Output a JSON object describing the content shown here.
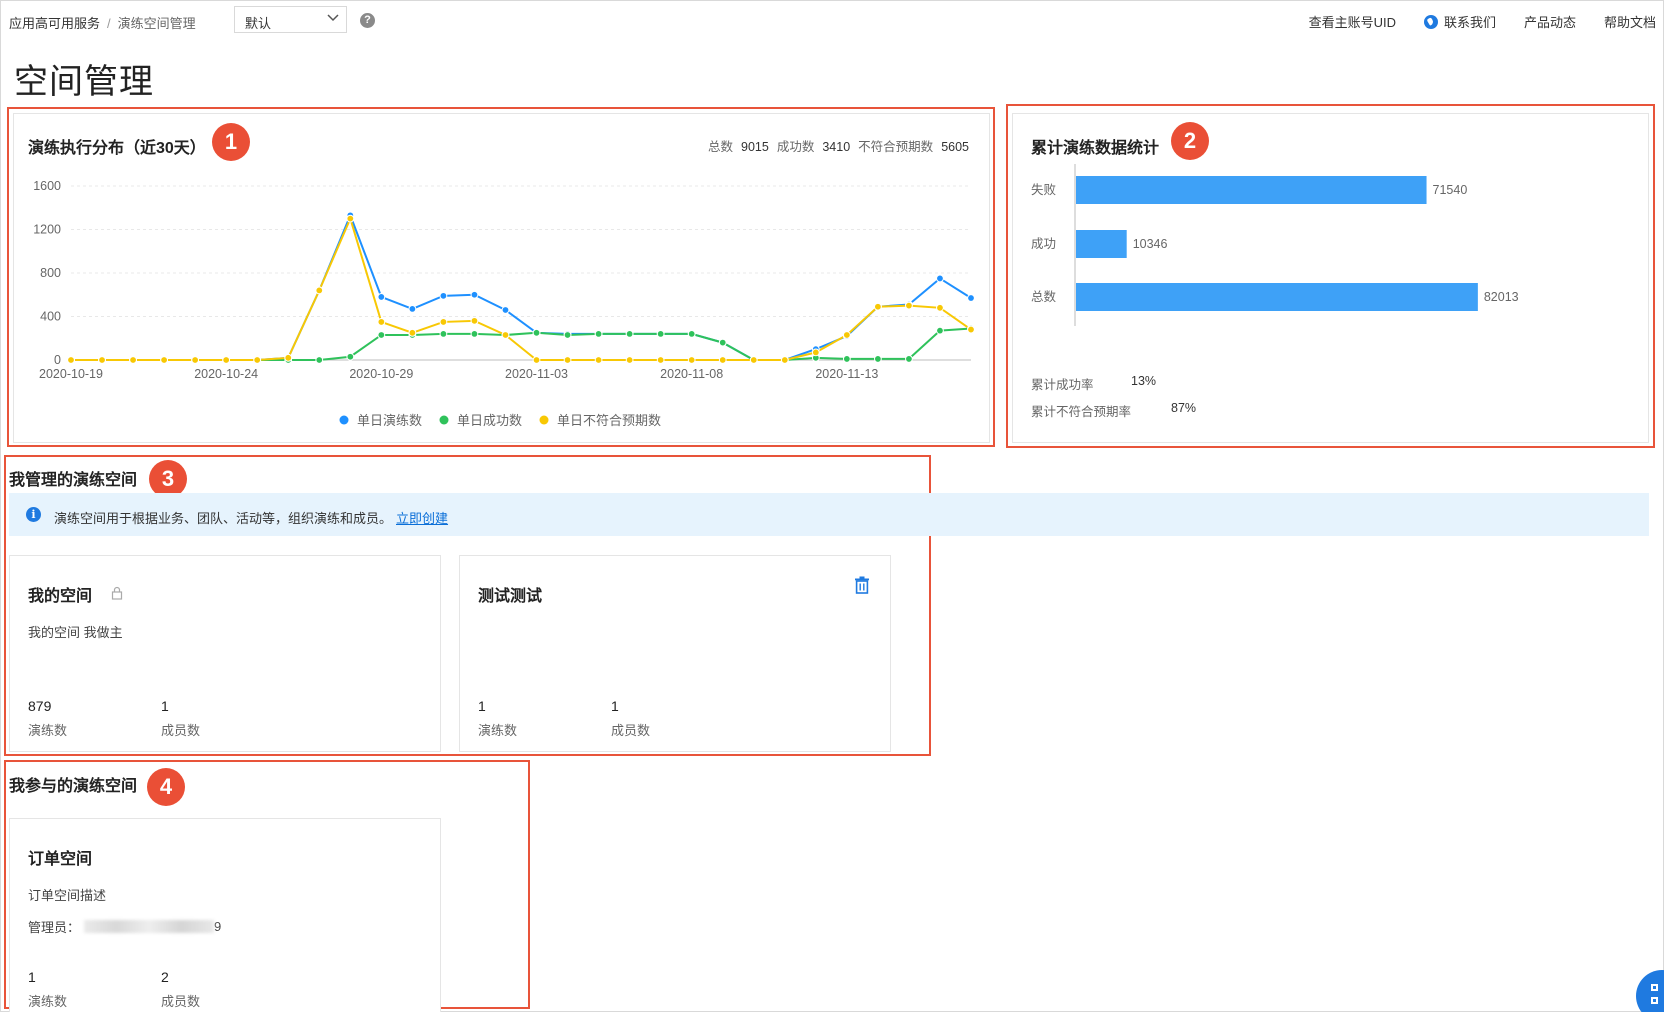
{
  "topbar": {
    "breadcrumb": [
      "应用高可用服务",
      "演练空间管理"
    ],
    "breadcrumb_sep": "/",
    "select_value": "默认",
    "help_icon": "question-circle-icon",
    "links": [
      "查看主账号UID",
      "联系我们",
      "产品动态",
      "帮助文档"
    ]
  },
  "page": {
    "title": "空间管理"
  },
  "markers": [
    "1",
    "2",
    "3",
    "4"
  ],
  "exec_dist": {
    "title": "演练执行分布（近30天）",
    "total_label": "总数",
    "total": "9015",
    "success_label": "成功数",
    "success": "3410",
    "unexpected_label": "不符合预期数",
    "unexpected": "5605",
    "chart_data": {
      "type": "line",
      "x": [
        "2020-10-19",
        "2020-10-20",
        "2020-10-21",
        "2020-10-22",
        "2020-10-23",
        "2020-10-24",
        "2020-10-25",
        "2020-10-26",
        "2020-10-27",
        "2020-10-28",
        "2020-10-29",
        "2020-10-30",
        "2020-10-31",
        "2020-11-01",
        "2020-11-02",
        "2020-11-03",
        "2020-11-04",
        "2020-11-05",
        "2020-11-06",
        "2020-11-07",
        "2020-11-08",
        "2020-11-09",
        "2020-11-10",
        "2020-11-11",
        "2020-11-12",
        "2020-11-13",
        "2020-11-14",
        "2020-11-15",
        "2020-11-16",
        "2020-11-17"
      ],
      "xticks": [
        "2020-10-19",
        "2020-10-24",
        "2020-10-29",
        "2020-11-03",
        "2020-11-08",
        "2020-11-13"
      ],
      "yticks": [
        "0",
        "400",
        "800",
        "1200",
        "1600"
      ],
      "ylim": [
        0,
        1600
      ],
      "series": [
        {
          "name": "单日演练数",
          "color": "#1e90ff",
          "values": [
            0,
            0,
            0,
            0,
            0,
            0,
            0,
            20,
            640,
            1330,
            580,
            470,
            590,
            600,
            460,
            250,
            240,
            240,
            240,
            240,
            240,
            160,
            0,
            0,
            100,
            220,
            490,
            510,
            750,
            570
          ]
        },
        {
          "name": "单日成功数",
          "color": "#2fc25b",
          "values": [
            0,
            0,
            0,
            0,
            0,
            0,
            0,
            0,
            0,
            30,
            230,
            230,
            240,
            240,
            230,
            250,
            230,
            240,
            240,
            240,
            240,
            160,
            0,
            0,
            20,
            10,
            10,
            10,
            270,
            290
          ]
        },
        {
          "name": "单日不符合预期数",
          "color": "#f8c804",
          "values": [
            0,
            0,
            0,
            0,
            0,
            0,
            0,
            20,
            640,
            1300,
            350,
            250,
            350,
            360,
            230,
            0,
            0,
            0,
            0,
            0,
            0,
            0,
            0,
            0,
            70,
            230,
            490,
            500,
            480,
            280
          ]
        }
      ],
      "legend_position": "bottom",
      "grid": true
    }
  },
  "cumulative": {
    "title": "累计演练数据统计",
    "chart_data": {
      "type": "bar",
      "orientation": "horizontal",
      "categories": [
        "失败",
        "成功",
        "总数"
      ],
      "values": [
        71540,
        10346,
        82013
      ],
      "value_labels": [
        "71540",
        "10346",
        "82013"
      ],
      "color": "#3ea1f7",
      "xlim": [
        0,
        100000
      ]
    },
    "success_rate_label": "累计成功率",
    "success_rate": "13%",
    "unexpected_rate_label": "累计不符合预期率",
    "unexpected_rate": "87%"
  },
  "managed": {
    "title": "我管理的演练空间",
    "info_icon": "info-circle-icon",
    "info_text": "演练空间用于根据业务、团队、活动等，组织演练和成员。",
    "info_link": "立即创建",
    "cards": [
      {
        "title": "我的空间",
        "icon": "lock-icon",
        "desc": "我的空间 我做主",
        "drills": "879",
        "drills_label": "演练数",
        "members": "1",
        "members_label": "成员数"
      },
      {
        "title": "测试测试",
        "icon": "trash-icon",
        "drills": "1",
        "drills_label": "演练数",
        "members": "1",
        "members_label": "成员数"
      }
    ]
  },
  "joined": {
    "title": "我参与的演练空间",
    "cards": [
      {
        "title": "订单空间",
        "desc": "订单空间描述",
        "admin_label": "管理员：",
        "admin_tail": "9",
        "drills": "1",
        "drills_label": "演练数",
        "members": "2",
        "members_label": "成员数"
      }
    ]
  },
  "float_button": {
    "icon": "grid-apps-icon"
  }
}
